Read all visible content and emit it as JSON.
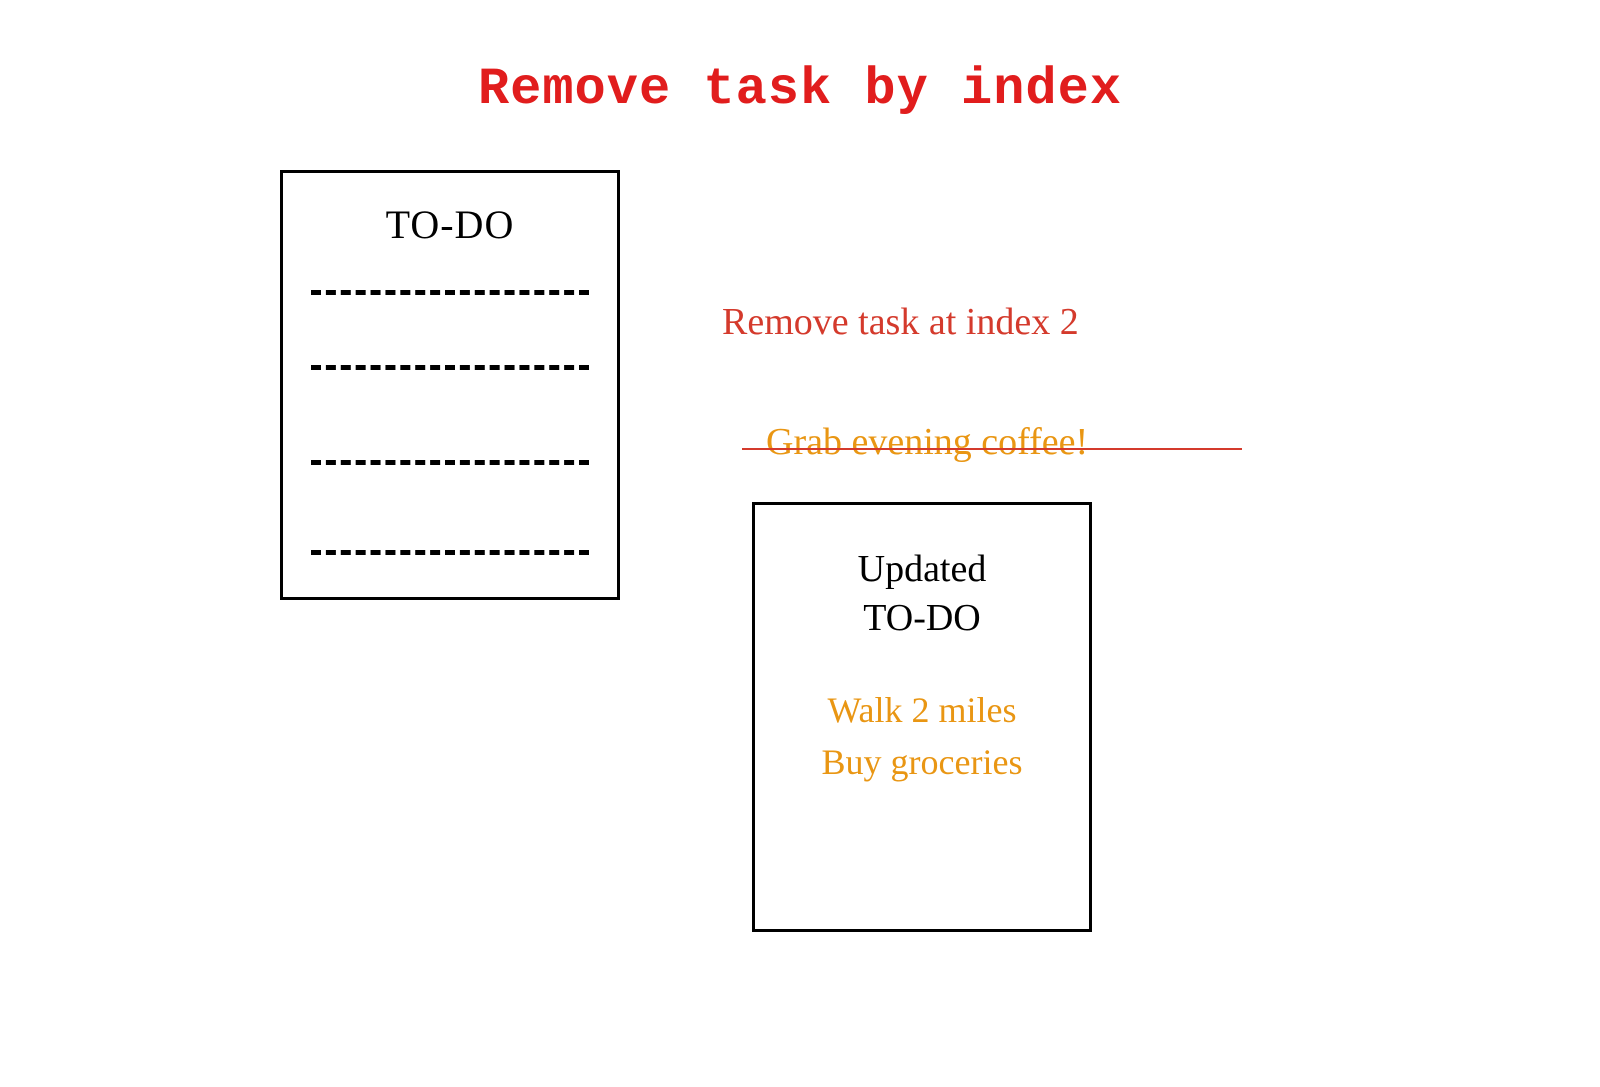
{
  "title": "Remove task by index",
  "left_box": {
    "heading": "TO-DO"
  },
  "instruction": "Remove task at index 2",
  "removed_task": "Grab evening coffee!",
  "updated_box": {
    "heading_line1": "Updated",
    "heading_line2": "TO-DO",
    "items": [
      "Walk 2 miles",
      "Buy groceries"
    ]
  },
  "colors": {
    "title_red": "#E11D1D",
    "handwritten_red": "#D43A2C",
    "orange": "#E99613",
    "black": "#000000"
  }
}
